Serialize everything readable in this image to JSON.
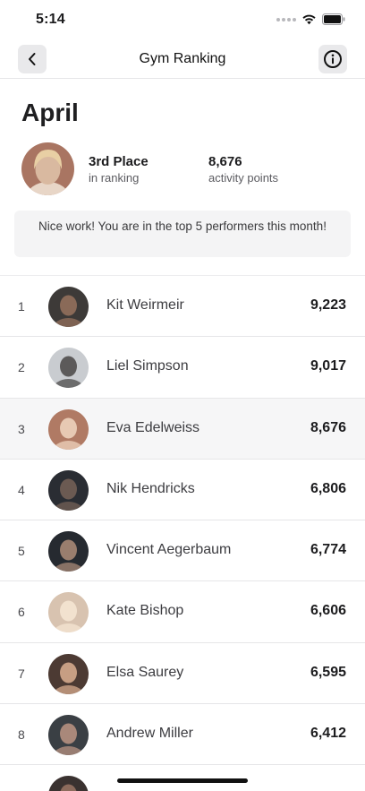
{
  "status_bar": {
    "time": "5:14"
  },
  "nav": {
    "title": "Gym Ranking",
    "back_icon": "chevron-left-icon",
    "info_icon": "info-circle-icon"
  },
  "summary": {
    "month": "April",
    "rank_value": "3rd Place",
    "rank_label": "in ranking",
    "points_value": "8,676",
    "points_label": "activity points",
    "notice": "Nice work! You are in the top 5 performers this month!"
  },
  "highlight_color": "#f6f6f7",
  "ranking": [
    {
      "position": "1",
      "name": "Kit Weirmeir",
      "score": "9,223",
      "avatar_bg": "#3d3a38",
      "avatar_fg": "#8a6a58"
    },
    {
      "position": "2",
      "name": "Liel Simpson",
      "score": "9,017",
      "avatar_bg": "#c9ccd0",
      "avatar_fg": "#5c5a5a"
    },
    {
      "position": "3",
      "name": "Eva Edelweiss",
      "score": "8,676",
      "avatar_bg": "#b07a64",
      "avatar_fg": "#e7c9b3",
      "highlight": true
    },
    {
      "position": "4",
      "name": "Nik Hendricks",
      "score": "6,806",
      "avatar_bg": "#2a2d33",
      "avatar_fg": "#6b5a52"
    },
    {
      "position": "5",
      "name": "Vincent Aegerbaum",
      "score": "6,774",
      "avatar_bg": "#262a30",
      "avatar_fg": "#9a7e6e"
    },
    {
      "position": "6",
      "name": "Kate Bishop",
      "score": "6,606",
      "avatar_bg": "#d8c3b0",
      "avatar_fg": "#f2e2cf"
    },
    {
      "position": "7",
      "name": "Elsa Saurey",
      "score": "6,595",
      "avatar_bg": "#4c3a33",
      "avatar_fg": "#c79e83"
    },
    {
      "position": "8",
      "name": "Andrew Miller",
      "score": "6,412",
      "avatar_bg": "#3a3f44",
      "avatar_fg": "#a9887a"
    },
    {
      "position": "",
      "name": "",
      "score": "",
      "avatar_bg": "#3a3230",
      "avatar_fg": "#8c6b5c"
    }
  ]
}
